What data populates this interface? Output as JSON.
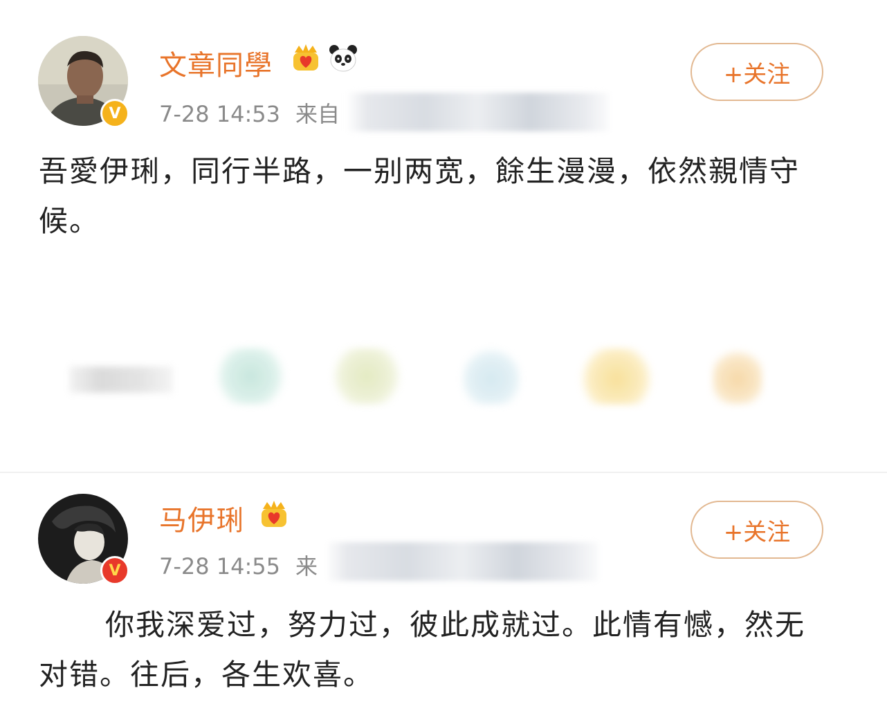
{
  "posts": [
    {
      "username": "文章同學",
      "time": "7-28 14:53",
      "source_prefix": "来自",
      "follow_label": "+关注",
      "text": "吾愛伊琍，同行半路，一别两宽，餘生漫漫，依然親情守候。",
      "badges": [
        "crown-heart-badge",
        "panda-badge"
      ],
      "verified_color": "#f5b21b",
      "avatar_icon": "man-portrait-avatar"
    },
    {
      "username": "马伊琍",
      "time": "7-28 14:55",
      "source_prefix": "来",
      "follow_label": "+关注",
      "text": "你我深爱过，努力过，彼此成就过。此情有憾，然无对错。往后，各生欢喜。",
      "badges": [
        "crown-heart-badge"
      ],
      "verified_color": "#e8392a",
      "avatar_icon": "woman-portrait-avatar"
    }
  ],
  "verified_mark": "V",
  "colors": {
    "username": "#e8742a",
    "meta": "#8a8a8a",
    "text": "#222222",
    "follow_border": "#e2b891"
  },
  "action_bar_icons": [
    "share-icon",
    "comment-icon",
    "like-icon",
    "repost-icon",
    "gift-icon",
    "favorite-icon"
  ]
}
